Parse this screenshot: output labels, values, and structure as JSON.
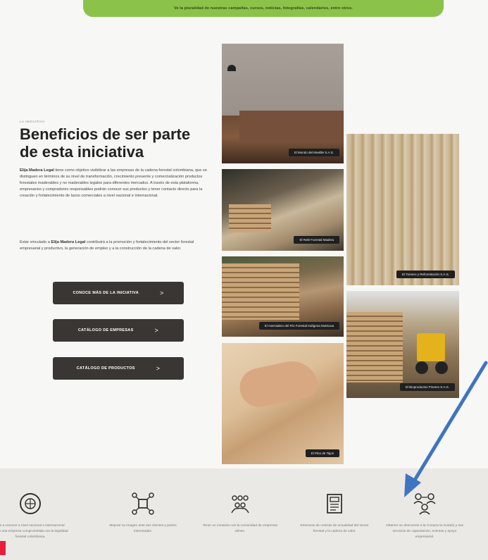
{
  "banner": {
    "text": "Ve la pluralidad de nuestras campañas, cursos, noticias, fotografías, calendarios, entre otros."
  },
  "section": {
    "eyebrow": "LA INICIATIVA",
    "title": "Beneficios de ser parte de esta iniciativa",
    "paragraph1_strong": "Elija Madera Legal",
    "paragraph1": " tiene como objetivo visibilizar a las empresas de la cadena forestal colombiana, que se distinguen en términos de su nivel de transformación, crecimiento presente y comercialización productos forestales maderables y no maderables legales para diferentes mercados. A través de esta plataforma, empresarios y compradores responsables podrán conocer sus productos y tener contacto directo para la creación y fortalecimiento de lazos comerciales a nivel nacional e internacional.",
    "paragraph2_pre": "Estar vinculado a ",
    "paragraph2_strong": "Elija Madera Legal",
    "paragraph2": " contribuirá a la promoción y fortalecimiento del sector forestal empresarial y productivo, la generación de empleo y a la construcción de la cadena de valor."
  },
  "buttons": [
    {
      "label": "CONOCE MÁS DE LA INICIATIVA",
      "chevron": ">"
    },
    {
      "label": "CATÁLOGO DE EMPRESAS",
      "chevron": ">"
    },
    {
      "label": "CATÁLOGO DE PRODUCTOS",
      "chevron": ">"
    }
  ],
  "photos": [
    {
      "caption": "El Mundo del Mueble S.A.S.",
      "icon": "living-room-photo"
    },
    {
      "caption": "El Relé Forestal Madera",
      "icon": "sawmill-photo"
    },
    {
      "caption": "El Aserradero del Río Forestal Indígena Mutiscua",
      "icon": "logs-worker-photo"
    },
    {
      "caption": "El Pino de Tajos",
      "icon": "wood-board-hand-photo"
    },
    {
      "caption": "El Tornero y Reforestación S.A.S.",
      "icon": "wood-rings-photo"
    },
    {
      "caption": "El Bioproductos Pinares S.A.S.",
      "icon": "lumber-loader-photo"
    }
  ],
  "features": [
    {
      "icon": "globe-chat-icon",
      "text": "Las a conocer a nivel nacional e internacional como una empresa comprometida con la legalidad forestal colombiana."
    },
    {
      "icon": "network-icon",
      "text": "Mejorar su imagen ante sus clientes y partes interesadas."
    },
    {
      "icon": "community-icon",
      "text": "Tener un contacto con la comunidad de empresas afines."
    },
    {
      "icon": "newspaper-icon",
      "text": "Enterarse de noticias de actualidad del sector forestal y la cadena de valor."
    },
    {
      "icon": "people-exchange-icon",
      "text": "Obtener un descuento a la Compra la Guía(s) y sus servicios de capacitación, eventos y apoyo empresarial."
    }
  ],
  "colors": {
    "banner": "#8bc34a",
    "button": "#3a3633",
    "arrow": "#3f74c2",
    "accent_red": "#e91e3d"
  }
}
